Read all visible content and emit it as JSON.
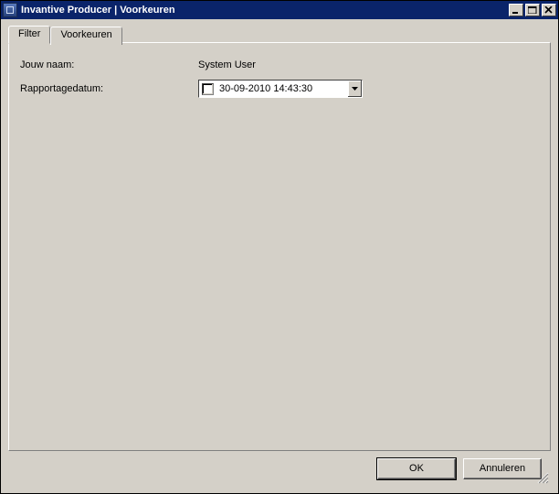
{
  "window": {
    "title": "Invantive Producer  |  Voorkeuren"
  },
  "tabs": {
    "filter": "Filter",
    "voorkeuren": "Voorkeuren"
  },
  "form": {
    "name_label": "Jouw naam:",
    "name_value": "System User",
    "date_label": "Rapportagedatum:",
    "date_value": "30-09-2010 14:43:30"
  },
  "buttons": {
    "ok": "OK",
    "cancel": "Annuleren"
  },
  "icons": {
    "minimize": "minimize-icon",
    "maximize": "maximize-icon",
    "close": "close-icon",
    "dropdown": "chevron-down-icon",
    "grip": "resize-grip-icon",
    "app": "app-icon"
  }
}
